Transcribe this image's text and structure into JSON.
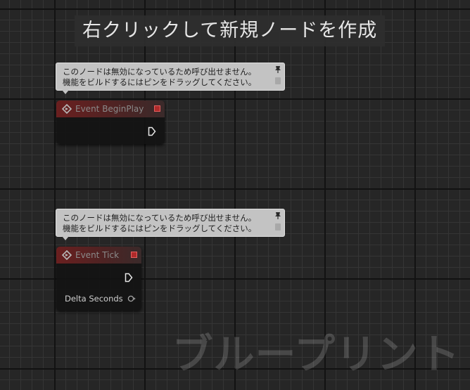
{
  "graph": {
    "hint_text": "右クリックして新規ノードを作成",
    "watermark": "ブループリント"
  },
  "nodes": [
    {
      "title": "Event BeginPlay",
      "comment_line1": "このノードは無効になっているため呼び出せません。",
      "comment_line2": "機能をビルドするにはピンをドラッグしてください。"
    },
    {
      "title": "Event Tick",
      "comment_line1": "このノードは無効になっているため呼び出せません。",
      "comment_line2": "機能をビルドするにはピンをドラッグしてください。",
      "output_label": "Delta Seconds"
    }
  ],
  "colors": {
    "event_header": "#6a1f1f",
    "delegate_pin": "#b02a2a",
    "float_pin": "#a5a5a5",
    "comment_bg": "#c3c3c3"
  },
  "icons": {
    "event": "event-diamond-icon",
    "pin": "pushpin-icon",
    "exec": "exec-arrow-icon",
    "float": "float-pin-icon"
  }
}
